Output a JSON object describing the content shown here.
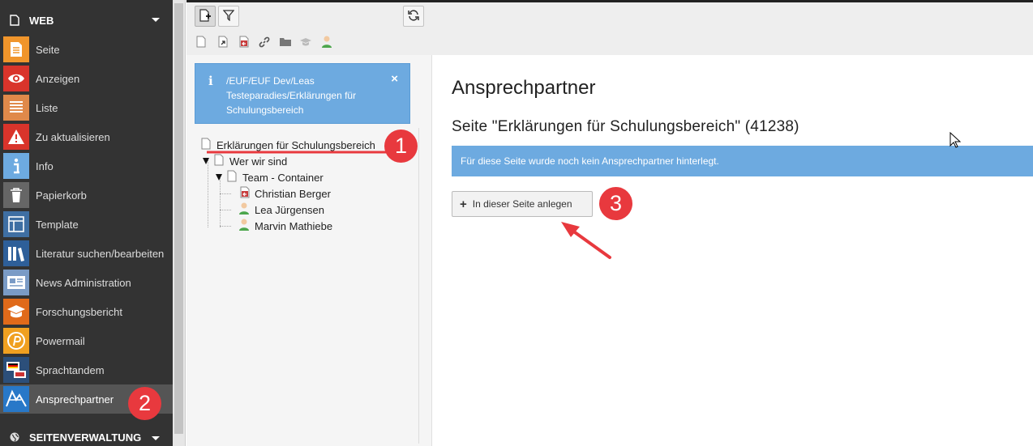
{
  "sidebar": {
    "section_web": "WEB",
    "section_pages": "SEITENVERWALTUNG",
    "items": [
      {
        "label": "Seite",
        "icon": "page-icon",
        "color": "#f0952b"
      },
      {
        "label": "Anzeigen",
        "icon": "eye-icon",
        "color": "#d9342b"
      },
      {
        "label": "Liste",
        "icon": "list-icon",
        "color": "#e0894a"
      },
      {
        "label": "Zu aktualisieren",
        "icon": "warning-icon",
        "color": "#d9342b"
      },
      {
        "label": "Info",
        "icon": "info-icon",
        "color": "#6daae0"
      },
      {
        "label": "Papierkorb",
        "icon": "trash-icon",
        "color": "#666666"
      },
      {
        "label": "Template",
        "icon": "template-icon",
        "color": "#3f6fa3"
      },
      {
        "label": "Literatur suchen/bearbeiten",
        "icon": "books-icon",
        "color": "#2e5f99"
      },
      {
        "label": "News Administration",
        "icon": "news-icon",
        "color": "#7a9bc6"
      },
      {
        "label": "Forschungsbericht",
        "icon": "graduation-cap-icon",
        "color": "#e06a1a"
      },
      {
        "label": "Powermail",
        "icon": "powermail-icon",
        "color": "#f0a020"
      },
      {
        "label": "Sprachtandem",
        "icon": "speech-bubbles-icon",
        "color": "#2c4f7a"
      },
      {
        "label": "Ansprechpartner",
        "icon": "contact-person-icon",
        "color": "#2878c8"
      }
    ]
  },
  "toolbar": {
    "new_page_icon": "new-page-icon",
    "filter_icon": "filter-icon",
    "refresh_icon": "refresh-icon"
  },
  "tree": {
    "info_path": "/EUF/EUF Dev/Leas Testeparadies/Erklärungen für Schulungsbereich",
    "info_close": "×",
    "nodes": [
      {
        "label": "Erklärungen für Schulungsbereich"
      },
      {
        "label": "Wer wir sind"
      },
      {
        "label": "Team - Container"
      },
      {
        "label": "Christian Berger"
      },
      {
        "label": "Lea Jürgensen"
      },
      {
        "label": "Marvin Mathiebe"
      }
    ]
  },
  "main": {
    "title": "Ansprechpartner",
    "subtitle": "Seite \"Erklärungen für Schulungsbereich\" (41238)",
    "alert": "Für diese Seite wurde noch kein Ansprechpartner hinterlegt.",
    "add_button": "In dieser Seite anlegen",
    "add_button_symbol": "+"
  },
  "annotations": {
    "badge1": "1",
    "badge2": "2",
    "badge3": "3",
    "color": "#e8393e"
  }
}
